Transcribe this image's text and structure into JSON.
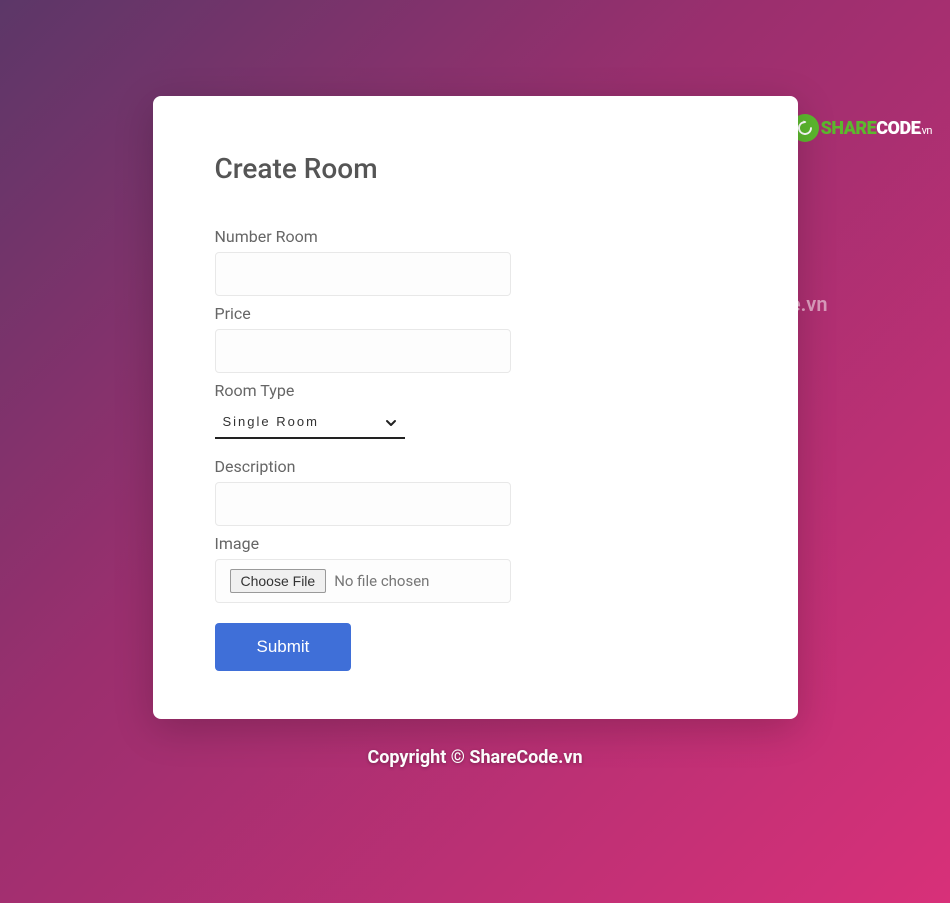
{
  "logo": {
    "share": "SHARE",
    "code": "CODE",
    "vn": ".vn"
  },
  "form": {
    "title": "Create Room",
    "number_room_label": "Number Room",
    "price_label": "Price",
    "room_type_label": "Room Type",
    "room_type_selected": "Single Room",
    "description_label": "Description",
    "image_label": "Image",
    "choose_file_button": "Choose File",
    "no_file_chosen": "No file chosen",
    "submit_label": "Submit"
  },
  "watermark": "ShareCode.vn",
  "copyright": "Copyright © ShareCode.vn"
}
